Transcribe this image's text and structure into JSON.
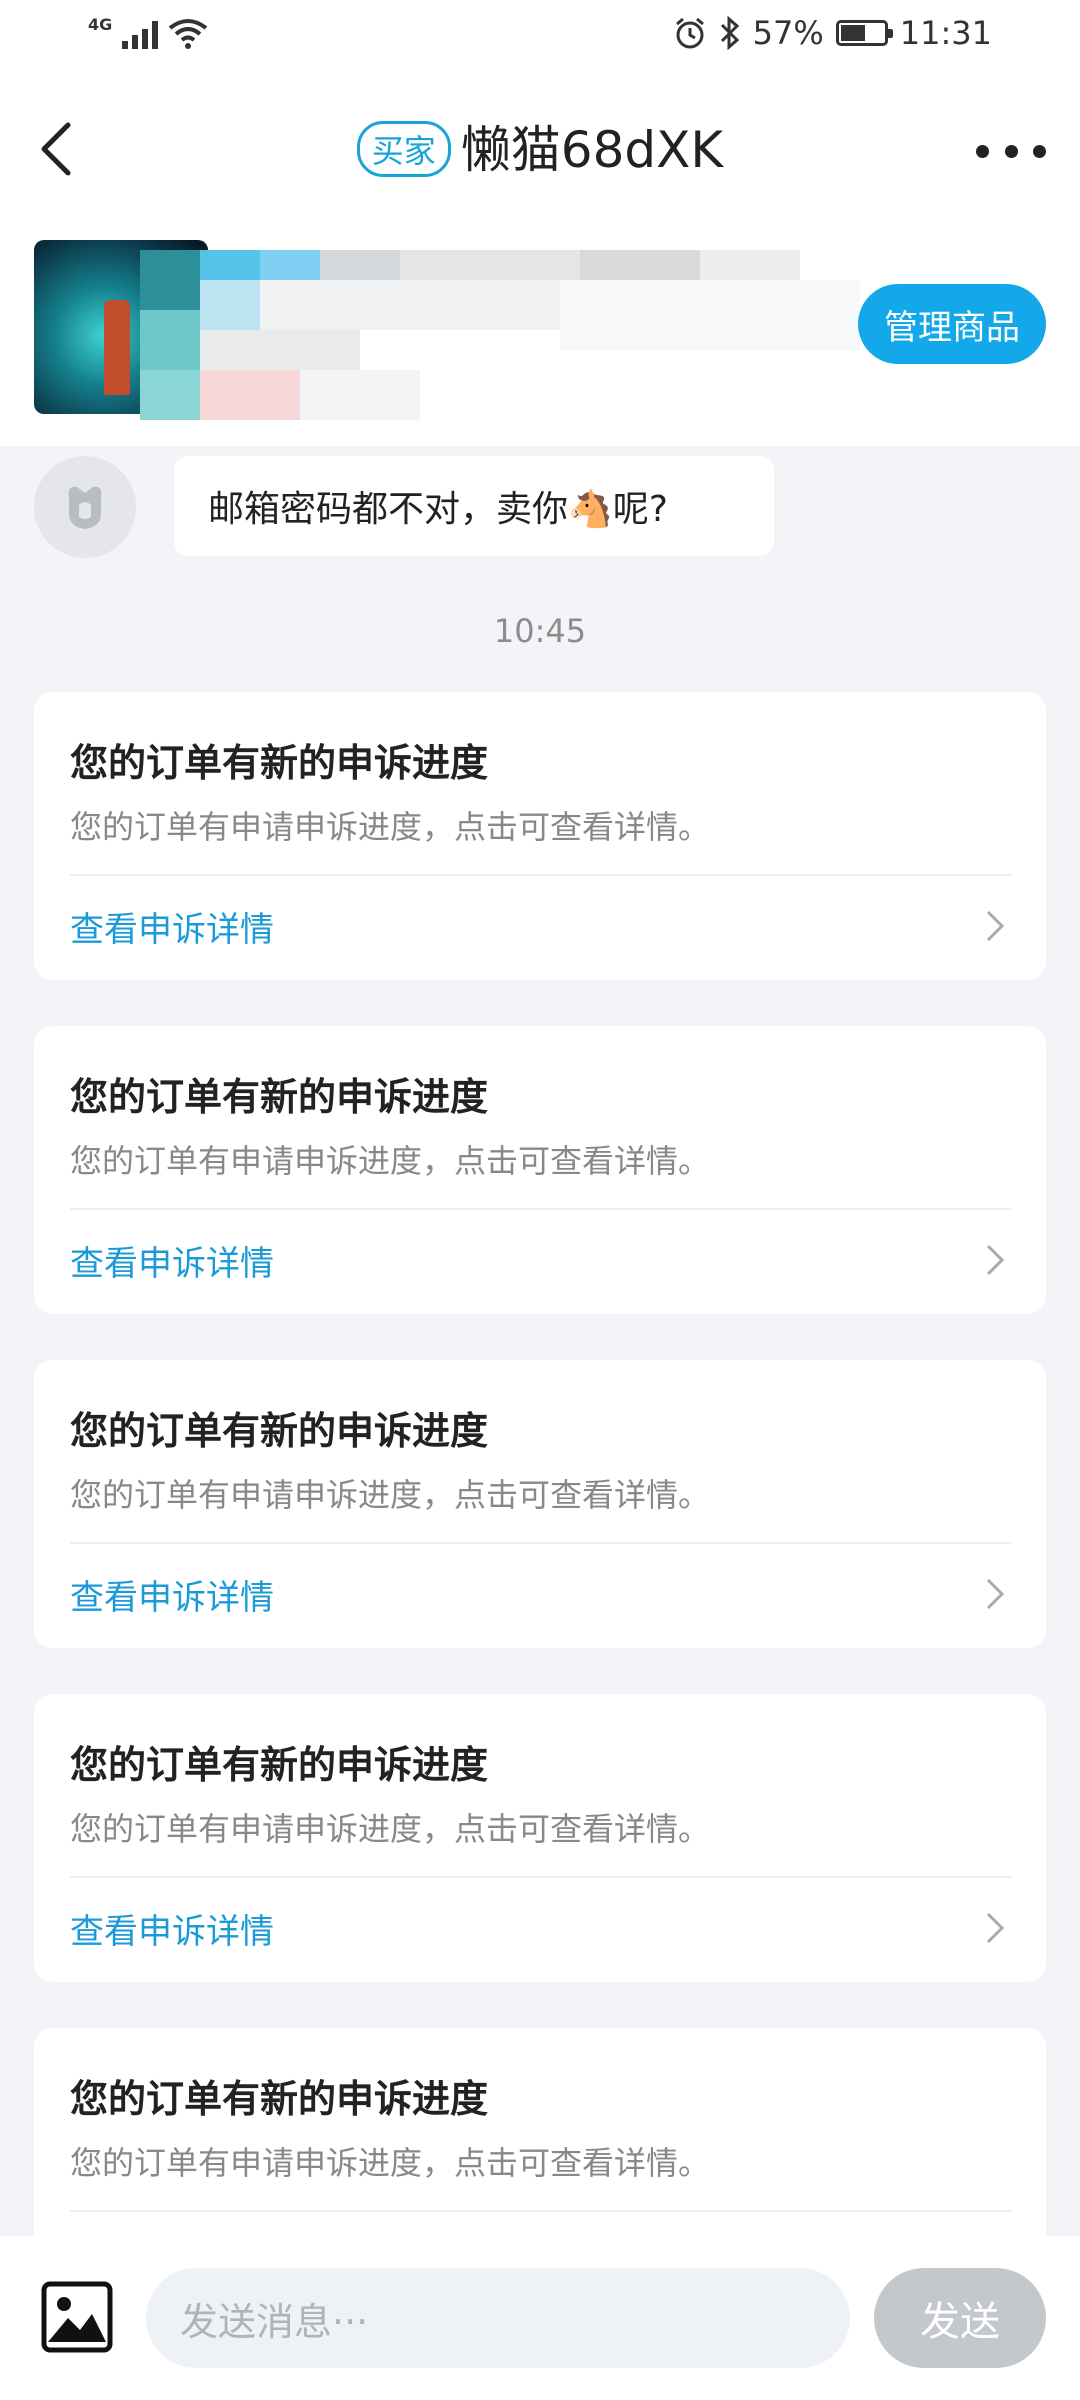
{
  "status_bar": {
    "network": "4G",
    "battery": "57%",
    "battery_level": 0.57,
    "time": "11:31"
  },
  "header": {
    "badge": "买家",
    "title": "懒猫68dXK"
  },
  "product": {
    "manage_label": "管理商品"
  },
  "messages": [
    {
      "text": "邮箱密码都不对，卖你🐴呢?"
    }
  ],
  "timestamp": "10:45",
  "cards": [
    {
      "title": "您的订单有新的申诉进度",
      "desc": "您的订单有申请申诉进度，点击可查看详情。",
      "link": "查看申诉详情"
    },
    {
      "title": "您的订单有新的申诉进度",
      "desc": "您的订单有申请申诉进度，点击可查看详情。",
      "link": "查看申诉详情"
    },
    {
      "title": "您的订单有新的申诉进度",
      "desc": "您的订单有申请申诉进度，点击可查看详情。",
      "link": "查看申诉详情"
    },
    {
      "title": "您的订单有新的申诉进度",
      "desc": "您的订单有申请申诉进度，点击可查看详情。",
      "link": "查看申诉详情"
    },
    {
      "title": "您的订单有新的申诉进度",
      "desc": "您的订单有申请申诉进度，点击可查看详情。",
      "link": ""
    }
  ],
  "input": {
    "placeholder": "发送消息···",
    "send_label": "发送"
  },
  "colors": {
    "accent": "#12a8ea",
    "link": "#1a9bd8",
    "background": "#f2f4f7"
  }
}
